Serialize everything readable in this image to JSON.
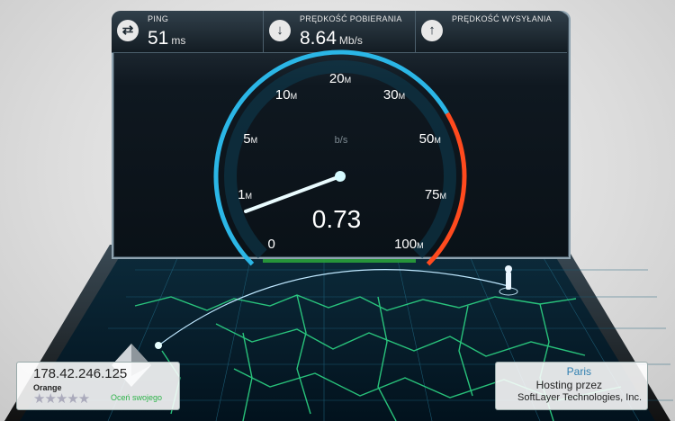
{
  "stats": {
    "ping": {
      "label": "PING",
      "value": "51",
      "unit": "ms",
      "icon": "ping-icon"
    },
    "download": {
      "label": "PRĘDKOŚĆ POBIERANIA",
      "value": "8.64",
      "unit": "Mb/s",
      "icon": "download-arrow-icon"
    },
    "upload": {
      "label": "PRĘDKOŚĆ WYSYŁANIA",
      "value": "",
      "unit": "",
      "icon": "upload-arrow-icon"
    }
  },
  "gauge": {
    "unit_label": "b/s",
    "current": "0.73",
    "ticks": [
      {
        "num": "0",
        "suffix": ""
      },
      {
        "num": "1",
        "suffix": "M"
      },
      {
        "num": "5",
        "suffix": "M"
      },
      {
        "num": "10",
        "suffix": "M"
      },
      {
        "num": "20",
        "suffix": "M"
      },
      {
        "num": "30",
        "suffix": "M"
      },
      {
        "num": "50",
        "suffix": "M"
      },
      {
        "num": "75",
        "suffix": "M"
      },
      {
        "num": "100",
        "suffix": "M"
      }
    ],
    "accent_blue": "#2bb6e6",
    "accent_red": "#ff4a1e"
  },
  "client": {
    "ip": "178.42.246.125",
    "isp": "Orange",
    "stars": "★★★★★",
    "rate_label": "Oceń swojego"
  },
  "server": {
    "city": "Paris",
    "line1": "Hosting przez",
    "line2": "SoftLayer Technologies, Inc."
  }
}
